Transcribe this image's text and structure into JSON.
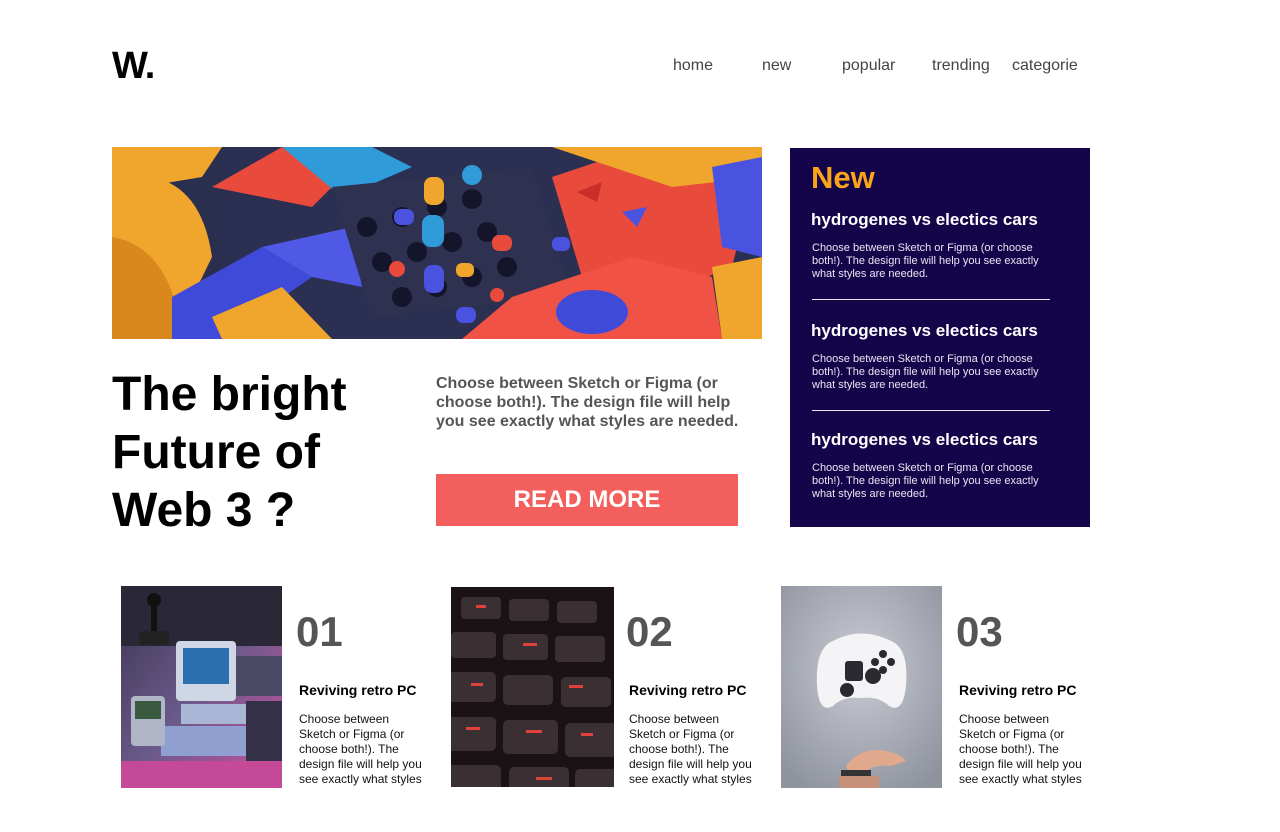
{
  "logo": "W.",
  "nav": [
    {
      "label": "home"
    },
    {
      "label": "new"
    },
    {
      "label": "popular"
    },
    {
      "label": "trending"
    },
    {
      "label": "categorie"
    }
  ],
  "hero": {
    "title_line1": "The bright",
    "title_line2": "Future of",
    "title_line3": "Web 3 ?",
    "description": "Choose between Sketch or Figma (or choose both!). The design file will help you see exactly what styles are needed.",
    "button_label": "READ MORE"
  },
  "new_panel": {
    "heading": "New",
    "items": [
      {
        "title": "hydrogenes vs electics cars",
        "text": "Choose between Sketch or Figma (or choose both!). The design file will help you see exactly what styles are needed."
      },
      {
        "title": "hydrogenes vs electics cars",
        "text": "Choose between Sketch or Figma (or choose both!). The design file will help you see exactly what styles are needed."
      },
      {
        "title": "hydrogenes vs electics cars",
        "text": "Choose between Sketch or Figma (or choose both!). The design file will help you see exactly what styles are needed."
      }
    ]
  },
  "cards": [
    {
      "number": "01",
      "title": "Reviving retro PC",
      "text": "Choose between Sketch or Figma (or choose both!). The design file will help you see exactly what styles are needed.",
      "image": "retro-computer-photo"
    },
    {
      "number": "02",
      "title": "Reviving retro PC",
      "text": "Choose between Sketch or Figma (or choose both!). The design file will help you see exactly what styles are needed.",
      "image": "keyboard-closeup-photo"
    },
    {
      "number": "03",
      "title": "Reviving retro PC",
      "text": "Choose between Sketch or Figma (or choose both!). The design file will help you see exactly what styles are needed.",
      "image": "floating-gamepad-photo"
    }
  ],
  "colors": {
    "accent_button": "#f25f5c",
    "panel_background": "#14054a",
    "panel_heading": "#f8a51b"
  }
}
